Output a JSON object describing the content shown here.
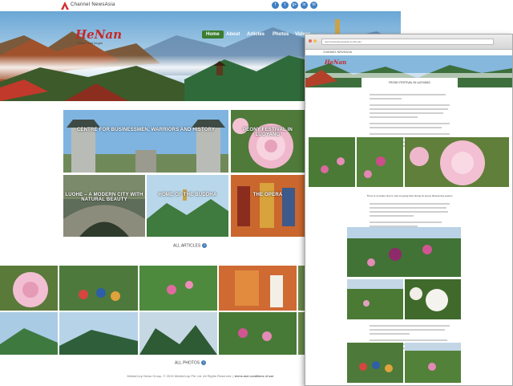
{
  "brand": {
    "name": "Channel NewsAsia",
    "logo_letter": "A"
  },
  "social_icons": [
    "f",
    "t",
    "g+",
    "in",
    "✉"
  ],
  "hero": {
    "title": "HeNan",
    "subtitle": "Where it all began"
  },
  "nav": {
    "items": [
      "Home",
      "About",
      "Articles",
      "Photos",
      "Videos"
    ],
    "active": "Home"
  },
  "articles": [
    {
      "label": "CENTRE FOR BUSINESSMEN, WARRIORS AND HISTORY"
    },
    {
      "label": "PEONY FESTIVAL IN LUOYANG"
    },
    {
      "label": "LUOHE – A MODERN CITY WITH NATURAL BEAUTY"
    },
    {
      "label": "HOME OF THE BUDDHA"
    },
    {
      "label": "THE OPERA"
    }
  ],
  "all_articles_label": "ALL ARTICLES",
  "all_photos_label": "ALL PHOTOS",
  "footer": {
    "text": "MediaCorp News Group. © 2015 MediaCorp Pte Ltd. All Rights Reserved. | ",
    "terms": "terms and conditions of use"
  },
  "second_window": {
    "url": "www.channelnewsasia.com/henan",
    "brand": "CHANNEL NEWSASIA",
    "hero_title": "HeNan",
    "article_title": "PEONY FESTIVAL IN LUOYANG",
    "caption": "There is no better time to visit Luoyang than during its peony blossoming season"
  },
  "colors": {
    "accent_green": "#3b7d2f",
    "title_red": "#c62828",
    "link_blue": "#4a7db8"
  }
}
